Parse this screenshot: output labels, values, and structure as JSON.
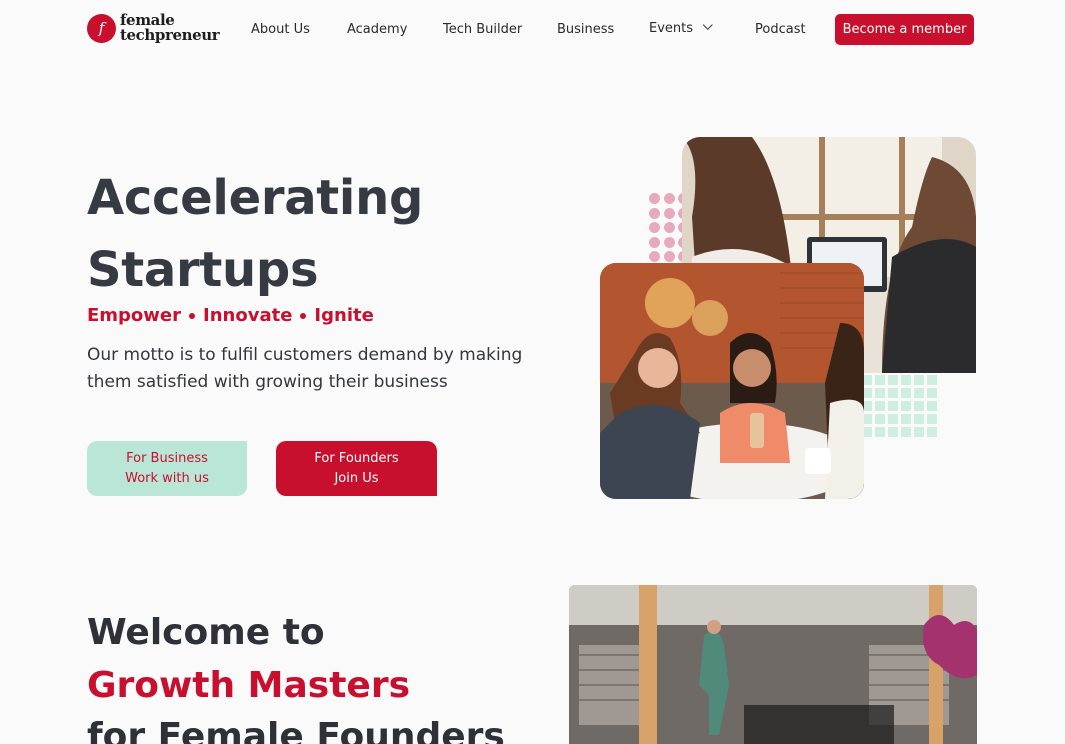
{
  "brand": {
    "line1": "female",
    "line2": "techpreneur",
    "mark": "f"
  },
  "nav": {
    "about": "About Us",
    "academy": "Academy",
    "tech_builder": "Tech Builder",
    "business": "Business",
    "events": "Events",
    "podcast": "Podcast",
    "cta": "Become a member"
  },
  "hero": {
    "title_line1": "Accelerating",
    "title_line2": "Startups",
    "tag1": "Empower",
    "tag2": "Innovate",
    "tag3": "Ignite",
    "motto": "Our motto is to fulfil customers demand by making them satisfied with growing their business",
    "business_btn": {
      "line1": "For Business",
      "line2": "Work with us"
    },
    "founders_btn": {
      "line1": "For Founders",
      "line2": "Join Us"
    }
  },
  "welcome": {
    "line1": "Welcome to",
    "line2": "Growth Masters",
    "line3": "for Female Founders"
  },
  "colors": {
    "accent": "#c8102e",
    "mint": "#b9e6d6",
    "pink_dots": "#e9a9bd"
  },
  "icons": {
    "events_dropdown": "chevron-down-icon",
    "logo": "female-techpreneur-logo-icon"
  }
}
